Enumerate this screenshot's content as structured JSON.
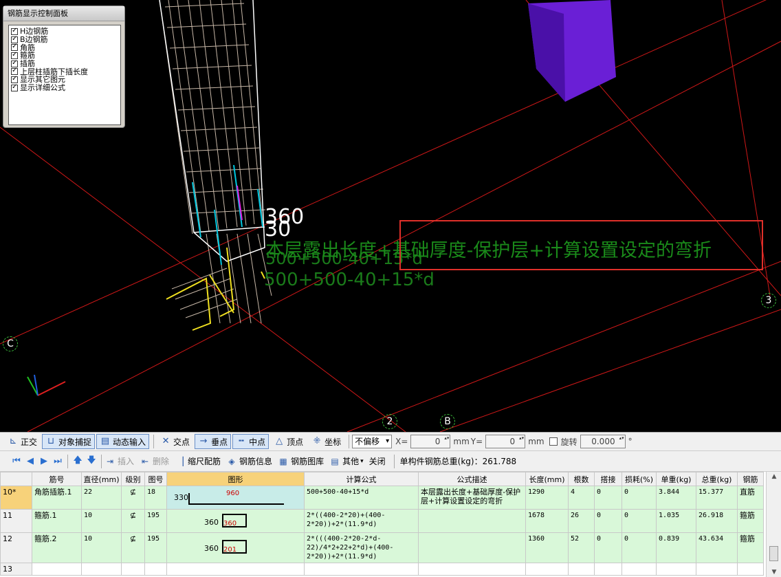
{
  "viewport": {
    "panel": {
      "title": "钢筋显示控制面板",
      "items": [
        {
          "label": "H边钢筋",
          "checked": true
        },
        {
          "label": "B边钢筋",
          "checked": true
        },
        {
          "label": "角筋",
          "checked": true
        },
        {
          "label": "箍筋",
          "checked": true
        },
        {
          "label": "插筋",
          "checked": true
        },
        {
          "label": "上层柱插筋下插长度",
          "checked": true
        },
        {
          "label": "显示其它图元",
          "checked": true
        },
        {
          "label": "显示详细公式",
          "checked": true
        }
      ]
    },
    "dim_360": "360",
    "dim_30": "30",
    "formula_overlay": "500+500-40+15*d",
    "formula_overlay_2": "500+500-40+15*d",
    "annotation": "本层露出长度+基础厚度-保护层+计算设置设定的弯折",
    "axis_labels": {
      "c": "C",
      "two": "2",
      "b": "B",
      "three": "3"
    },
    "colors": {
      "grid_line": "#d01818",
      "column_purple": "#6a1fd6",
      "annotation_box": "#e0302a",
      "annotation_text": "#1a8a1a"
    }
  },
  "toolbar1": {
    "ortho": "正交",
    "snap": "对象捕捉",
    "dyn_input": "动态输入",
    "intersect": "交点",
    "perp": "垂点",
    "mid": "中点",
    "vertex": "顶点",
    "coord": "坐标",
    "offset_mode": "不偏移",
    "x_label": "X=",
    "x_value": "0",
    "mm1": "mm",
    "y_label": "Y=",
    "y_value": "0",
    "mm2": "mm",
    "rotate": "旋转",
    "rotate_value": "0.000",
    "deg": "°"
  },
  "toolbar2": {
    "insert": "插入",
    "delete": "删除",
    "scale_rebar": "缩尺配筋",
    "rebar_info": "钢筋信息",
    "rebar_lib": "钢筋图库",
    "other": "其他",
    "close": "关闭",
    "total_weight": "单构件钢筋总重(kg)：261.788"
  },
  "grid": {
    "headers": [
      "筋号",
      "直径(mm)",
      "级别",
      "图号",
      "图形",
      "计算公式",
      "公式描述",
      "长度(mm)",
      "根数",
      "搭接",
      "损耗(%)",
      "单重(kg)",
      "总重(kg)",
      "钢筋"
    ],
    "rows": [
      {
        "rn": "10*",
        "name": "角筋插筋.1",
        "dia": "22",
        "grade": "⊈",
        "fig": "18",
        "shape_l": "330",
        "shape_r": "960",
        "formula": "500+500-40+15*d",
        "desc": "本层露出长度+基础厚度-保护层+计算设置设定的弯折",
        "len": "1290",
        "count": "4",
        "lap": "0",
        "loss": "0",
        "unit_w": "3.844",
        "total_w": "15.377",
        "type": "直筋"
      },
      {
        "rn": "11",
        "name": "箍筋.1",
        "dia": "10",
        "grade": "⊈",
        "fig": "195",
        "shape_l": "360",
        "shape_r": "360",
        "formula": "2*((400-2*20)+(400-2*20))+2*(11.9*d)",
        "desc": "",
        "len": "1678",
        "count": "26",
        "lap": "0",
        "loss": "0",
        "unit_w": "1.035",
        "total_w": "26.918",
        "type": "箍筋"
      },
      {
        "rn": "12",
        "name": "箍筋.2",
        "dia": "10",
        "grade": "⊈",
        "fig": "195",
        "shape_l": "360",
        "shape_r": "201",
        "formula": "2*(((400-2*20-2*d-22)/4*2+22+2*d)+(400-2*20))+2*(11.9*d)",
        "desc": "",
        "len": "1360",
        "count": "52",
        "lap": "0",
        "loss": "0",
        "unit_w": "0.839",
        "total_w": "43.634",
        "type": "箍筋"
      },
      {
        "rn": "13",
        "blank": true
      }
    ]
  }
}
